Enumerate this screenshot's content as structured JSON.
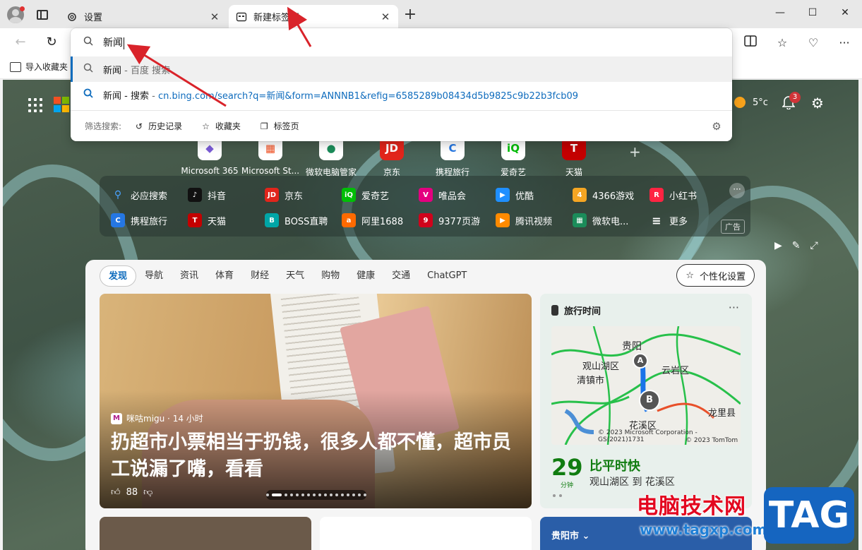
{
  "tabs": [
    {
      "label": "设置",
      "icon": "gear-icon",
      "active": false
    },
    {
      "label": "新建标签页",
      "icon": "new-tab-page-icon",
      "active": true
    }
  ],
  "omnibox": {
    "typed": "新闻",
    "suggestions": [
      {
        "text": "新闻",
        "suffix": "百度 搜索",
        "selected": true
      },
      {
        "text": "新闻 - 搜索",
        "url": "cn.bing.com/search?q=新闻&form=ANNNB1&refig=6585289b08434d5b9825c9b22b3fcb09",
        "selected": false
      }
    ],
    "filter_label": "筛选搜索:",
    "filters": [
      "历史记录",
      "收藏夹",
      "标签页"
    ]
  },
  "favorites_bar": {
    "import_label": "导入收藏夹"
  },
  "weather": {
    "temp": "5°c"
  },
  "notifications": {
    "count": "3"
  },
  "quick_links": [
    {
      "label": "Microsoft 365",
      "glyph": "◆",
      "color": "#7a5bd6"
    },
    {
      "label": "Microsoft St...",
      "glyph": "▦",
      "color": "#f25022"
    },
    {
      "label": "微软电脑管家",
      "glyph": "●",
      "color": "#1b8c5a"
    },
    {
      "label": "京东",
      "glyph": "JD",
      "color": "#e1251b"
    },
    {
      "label": "携程旅行",
      "glyph": "C",
      "color": "#2577e3"
    },
    {
      "label": "爱奇艺",
      "glyph": "iQ",
      "color": "#00be06"
    },
    {
      "label": "天猫",
      "glyph": "T",
      "color": "#c40000"
    }
  ],
  "shortcuts": [
    {
      "label": "必应搜索",
      "glyph": "Q",
      "color": "#0f6cbd"
    },
    {
      "label": "抖音",
      "glyph": "♪",
      "color": "#111111"
    },
    {
      "label": "京东",
      "glyph": "JD",
      "color": "#e1251b"
    },
    {
      "label": "爱奇艺",
      "glyph": "iQ",
      "color": "#00be06"
    },
    {
      "label": "唯品会",
      "glyph": "V",
      "color": "#e4007f"
    },
    {
      "label": "优酷",
      "glyph": "▶",
      "color": "#1f8fff"
    },
    {
      "label": "4366游戏",
      "glyph": "4",
      "color": "#f5a623"
    },
    {
      "label": "小红书",
      "glyph": "R",
      "color": "#ff2442"
    },
    {
      "label": "携程旅行",
      "glyph": "C",
      "color": "#2577e3"
    },
    {
      "label": "天猫",
      "glyph": "T",
      "color": "#c40000"
    },
    {
      "label": "BOSS直聘",
      "glyph": "B",
      "color": "#00a6a7"
    },
    {
      "label": "阿里1688",
      "glyph": "a",
      "color": "#ff6a00"
    },
    {
      "label": "9377页游",
      "glyph": "9",
      "color": "#d0021b"
    },
    {
      "label": "腾讯视频",
      "glyph": "▶",
      "color": "#ff8a00"
    },
    {
      "label": "微软电...",
      "glyph": "▦",
      "color": "#1b8c5a"
    },
    {
      "label": "更多",
      "glyph": "≡",
      "color": "#555555"
    }
  ],
  "ad_label": "广告",
  "feed": {
    "tabs": [
      "发现",
      "导航",
      "资讯",
      "体育",
      "财经",
      "天气",
      "购物",
      "健康",
      "交通",
      "ChatGPT"
    ],
    "personalize_label": "个性化设置",
    "hero": {
      "source": "咪咕migu · 14 小时",
      "title": "扔超市小票相当于扔钱，很多人都不懂，超市员工说漏了嘴，看看",
      "likes": "88"
    },
    "travel": {
      "title": "旅行时间",
      "map_labels": [
        "贵阳",
        "观山湖区",
        "云岩区",
        "清镇市",
        "龙里县",
        "花溪区"
      ],
      "pins": [
        "A",
        "B"
      ],
      "credit1": "© 2023 Microsoft Corporation - GS(2021)1731",
      "credit2": "© 2023 TomTom",
      "minutes": "29",
      "minutes_unit": "分钟",
      "status": "比平时快",
      "route": "观山湖区 到 花溪区"
    },
    "city_card": "贵阳市"
  },
  "watermark": {
    "text": "电脑技术网",
    "url": "www.tagxp.com",
    "logo": "TAG"
  },
  "colors": {
    "accent": "#0f6cbd",
    "arrow": "#d9232a",
    "traffic_good": "#107c10"
  }
}
